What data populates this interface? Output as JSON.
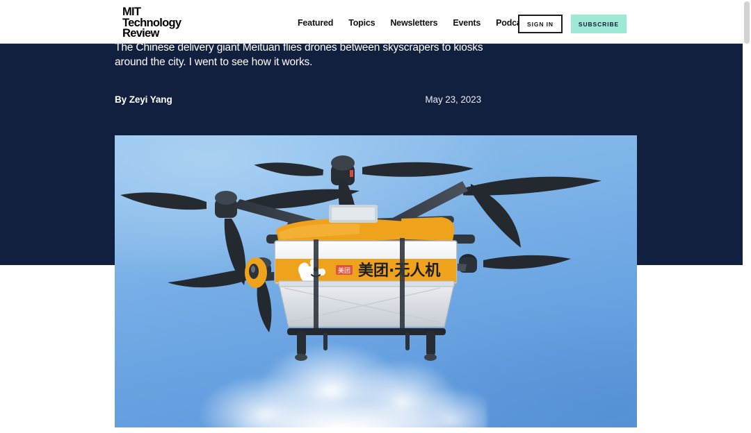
{
  "header": {
    "logo": {
      "line1": "MIT",
      "line2": "Technology",
      "line3": "Review"
    },
    "nav": [
      {
        "label": "Featured",
        "name": "nav-featured"
      },
      {
        "label": "Topics",
        "name": "nav-topics"
      },
      {
        "label": "Newsletters",
        "name": "nav-newsletters"
      },
      {
        "label": "Events",
        "name": "nav-events"
      },
      {
        "label": "Podcasts",
        "name": "nav-podcasts"
      }
    ],
    "sign_in_label": "SIGN IN",
    "subscribe_label": "SUBSCRIBE",
    "accent_subscribe": "#9ee8d6",
    "border_signin": "#1c1c1c"
  },
  "article": {
    "dek": "The Chinese delivery giant Meituan flies drones between skyscrapers to kiosks around the city. I went to see how it works.",
    "byline": "By Zeyi Yang",
    "date": "May 23, 2023",
    "band_color": "#12203f"
  },
  "hero_image": {
    "alt": "Meituan delivery drone flying against a blue sky with a white cloud",
    "drone_brand_text": "美团·无人机",
    "drone_badge_text": "美团",
    "sky_color": "#7fb4e8",
    "drone_accent_color": "#f2a218",
    "drone_body_color": "#3a3f46"
  },
  "scrollbar": {
    "position_label": "top"
  }
}
